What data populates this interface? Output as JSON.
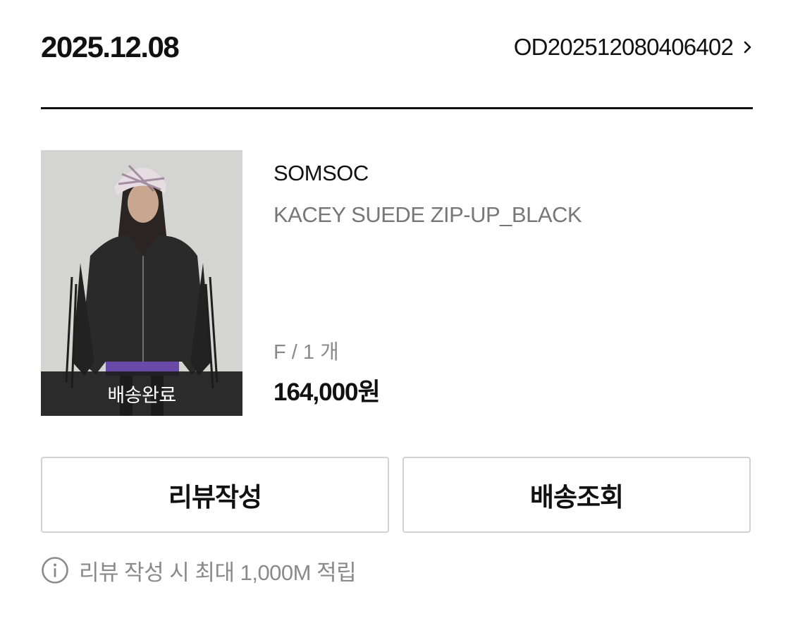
{
  "order": {
    "date": "2025.12.08",
    "number": "OD202512080406402",
    "chevron_icon": "chevron-right-icon"
  },
  "product": {
    "image_icon": "product-photo",
    "status": "배송완료",
    "brand": "SOMSOC",
    "name": "KACEY SUEDE ZIP-UP_BLACK",
    "option": "F / 1 개",
    "price": "164,000원"
  },
  "actions": {
    "review_label": "리뷰작성",
    "tracking_label": "배송조회"
  },
  "notice": {
    "icon": "info-icon",
    "text": "리뷰 작성 시 최대 1,000M 적립"
  },
  "colors": {
    "text_primary": "#111111",
    "text_secondary": "#777777",
    "border": "#d2d2d2",
    "overlay": "#1c1c1c"
  }
}
